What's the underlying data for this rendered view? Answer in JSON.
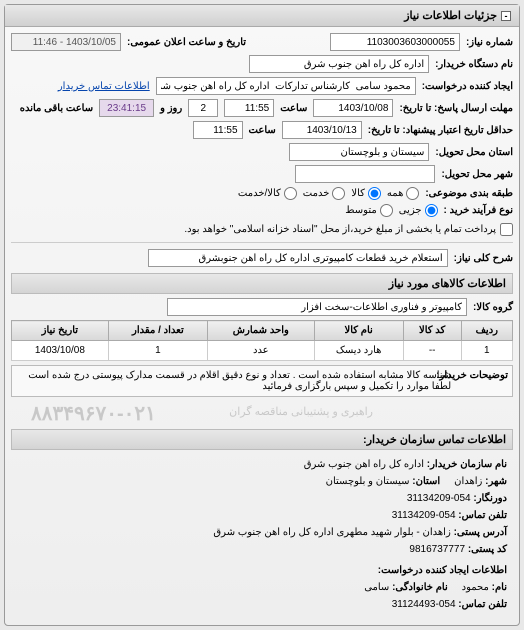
{
  "panel_title": "جزئیات اطلاعات نیاز",
  "top": {
    "req_no_label": "شماره نیاز:",
    "req_no": "1103003603000055",
    "announce_label": "تاریخ و ساعت اعلان عمومی:",
    "announce_val": "1403/10/05 - 11:46",
    "org_label": "نام دستگاه خریدار:",
    "org_val": "اداره کل راه اهن جنوب شرق",
    "creator_label": "ایجاد کننده درخواست:",
    "creator_val": "محمود سامی  کارشناس تدارکات  اداره کل راه اهن جنوب شرق",
    "buyer_contact_link": "اطلاعات تماس خریدار",
    "deadline_label": "مهلت ارسال پاسخ: تا تاریخ:",
    "deadline_date": "1403/10/08",
    "time_label": "ساعت",
    "deadline_time": "11:55",
    "days_val": "2",
    "days_label": "روز و",
    "remain_time": "23:41:15",
    "remain_label": "ساعت باقی مانده",
    "validity_label": "حداقل تاریخ اعتبار پیشنهاد: تا تاریخ:",
    "validity_date": "1403/10/13",
    "validity_time": "11:55",
    "province_label": "استان محل تحویل:",
    "province_val": "سیستان و بلوچستان",
    "city_label": "شهر محل تحویل:",
    "group_label": "طبقه بندی موضوعی:",
    "group_all": "همه",
    "group_goods": "کالا",
    "group_service": "خدمت",
    "group_goods_service": "کالا/خدمت",
    "proc_label": "نوع فرآیند خرید :",
    "proc_minor": "جزیی",
    "proc_medium": "متوسط",
    "proc_note": "پرداخت تمام یا بخشی از مبلغ خرید،از محل \"اسناد خزانه اسلامی\" خواهد بود.",
    "subject_label": "شرح کلی نیاز:",
    "subject_val": "استعلام خرید قطعات کامپیوتری اداره کل راه اهن جنوبشرق"
  },
  "goods_section_title": "اطلاعات کالاهای مورد نیاز",
  "goods_group_label": "گروه کالا:",
  "goods_group_val": "کامپیوتر و فناوری اطلاعات-سخت افزار",
  "table": {
    "headers": [
      "ردیف",
      "کد کالا",
      "نام کالا",
      "واحد شمارش",
      "تعداد / مقدار",
      "تاریخ نیاز"
    ],
    "rows": [
      {
        "idx": "1",
        "code": "--",
        "name": "هارد دیسک",
        "unit": "عدد",
        "qty": "1",
        "date": "1403/10/08"
      }
    ]
  },
  "buyer_desc_label": "توضیحات خریدار:",
  "buyer_desc_text": "شناسه کالا مشابه استفاده شده است . تعداد و نوع دقیق اقلام در قسمت مدارک پیوستی درج شده است لطفا موارد را تکمیل و سپس بارگزاری فرمائید",
  "watermark": "۸۸۳۴۹۶۷۰-۰۲۱",
  "watermark_label": "راهبری و پشتیبانی مناقصه گران",
  "contact_title": "اطلاعات تماس سازمان خریدار:",
  "contact": {
    "org_label": "نام سازمان خریدار:",
    "org": "اداره کل راه اهن جنوب شرق",
    "city_label": "شهر:",
    "city": "زاهدان",
    "province_label": "استان:",
    "province": "سیستان و بلوچستان",
    "fax_label": "دورنگار:",
    "fax": "054-31134209",
    "phone_label": "تلفن تماس:",
    "phone": "054-31134209",
    "addr_label": "آدرس پستی:",
    "addr": "زاهدان - بلوار شهید مطهری اداره کل راه اهن جنوب شرق",
    "post_label": "کد پستی:",
    "post": "9816737777",
    "creator_section": "اطلاعات ایجاد کننده درخواست:",
    "name_label": "نام:",
    "name": "محمود",
    "family_label": "نام خانوادگی:",
    "family": "سامی",
    "cphone_label": "تلفن تماس:",
    "cphone": "054-31124493"
  }
}
